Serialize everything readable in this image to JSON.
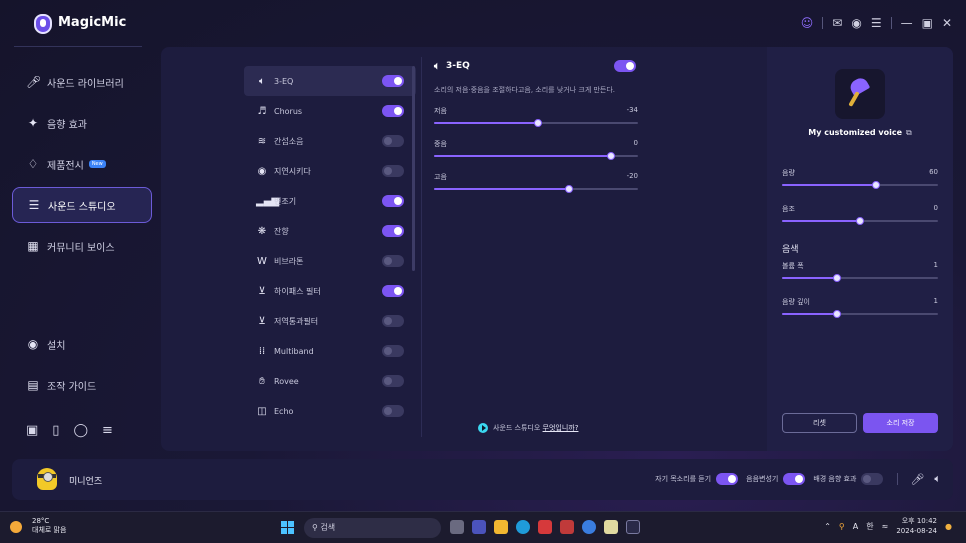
{
  "app": {
    "title": "MagicMic"
  },
  "sidebar": {
    "items": [
      {
        "label": "사운드 라이브러리",
        "icon": "microphone-icon"
      },
      {
        "label": "음향 효과",
        "icon": "sparkle-icon"
      },
      {
        "label": "제품전시",
        "icon": "diamond-icon",
        "badge": "New"
      },
      {
        "label": "사운드 스튜디오",
        "icon": "sliders-icon",
        "active": true
      },
      {
        "label": "커뮤니티 보이스",
        "icon": "community-icon"
      }
    ],
    "bottom": [
      {
        "label": "설치",
        "icon": "settings-icon"
      },
      {
        "label": "조작 가이드",
        "icon": "guide-icon"
      }
    ]
  },
  "effects": [
    {
      "label": "3-EQ",
      "icon": "speaker-icon",
      "on": true
    },
    {
      "label": "Chorus",
      "icon": "chorus-icon",
      "on": true
    },
    {
      "label": "간섭소음",
      "icon": "noise-icon",
      "on": false
    },
    {
      "label": "지연시키다",
      "icon": "delay-icon",
      "on": false
    },
    {
      "label": "변조기",
      "icon": "bars-icon",
      "on": true
    },
    {
      "label": "잔향",
      "icon": "reverb-icon",
      "on": true
    },
    {
      "label": "비브라톤",
      "icon": "wave-icon",
      "on": false
    },
    {
      "label": "하이패스 필터",
      "icon": "highpass-icon",
      "on": true
    },
    {
      "label": "저역통과필터",
      "icon": "lowpass-icon",
      "on": false
    },
    {
      "label": "Multiband",
      "icon": "multiband-icon",
      "on": false
    },
    {
      "label": "Rovee",
      "icon": "hand-icon",
      "on": false
    },
    {
      "label": "Echo",
      "icon": "echo-icon",
      "on": false
    }
  ],
  "eq": {
    "title": "3-EQ",
    "enabled": true,
    "description": "소리의 저음·중음을 조절하다고음, 소리를 낮거나 크게 만든다.",
    "sliders": [
      {
        "label": "저음",
        "value": "-34",
        "fraction": 0.51
      },
      {
        "label": "중음",
        "value": "0",
        "fraction": 0.87
      },
      {
        "label": "고음",
        "value": "-20",
        "fraction": 0.66
      }
    ],
    "help_prefix": "사운드 스튜디오",
    "help_link": "무엇입니까?"
  },
  "voice": {
    "name": "My customized voice",
    "volume": {
      "label": "음량",
      "value": "60",
      "fraction": 0.6
    },
    "pitch": {
      "label": "음조",
      "value": "0",
      "fraction": 0.5
    },
    "timbre_label": "음색",
    "timbre_width": {
      "label": "볼륨 폭",
      "value": "1",
      "fraction": 0.35
    },
    "timbre_depth": {
      "label": "음량 깊이",
      "value": "1",
      "fraction": 0.35
    },
    "reset_label": "리셋",
    "save_label": "소리 저장"
  },
  "bottombar": {
    "voice_label": "미니언즈",
    "hear_self_label": "자기 목소리를 듣기",
    "hear_self_on": true,
    "voice_change_label": "음음변성기",
    "voice_change_on": true,
    "bg_effect_label": "배경 음향 효과",
    "bg_effect_on": false
  },
  "taskbar": {
    "temp": "28°C",
    "weather": "대체로 맑음",
    "search_placeholder": "검색",
    "lang_a": "A",
    "lang_han": "한",
    "time": "오후 10:42",
    "date": "2024-08-24"
  },
  "colors": {
    "accent": "#7c55f2",
    "panel": "#1d1c3e",
    "background": "#15142b"
  }
}
